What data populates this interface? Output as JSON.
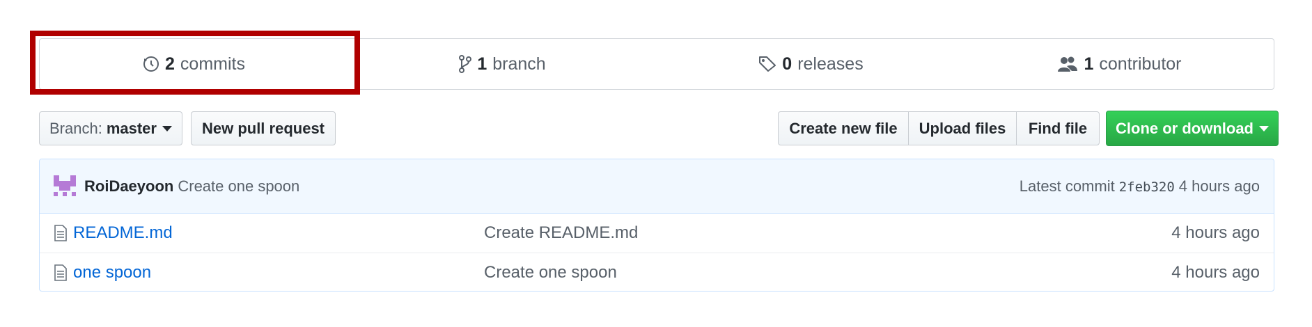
{
  "summary": {
    "commits": {
      "count": "2",
      "label": "commits",
      "icon": "history-icon"
    },
    "branches": {
      "count": "1",
      "label": "branch",
      "icon": "git-branch-icon"
    },
    "releases": {
      "count": "0",
      "label": "releases",
      "icon": "tag-icon"
    },
    "contributors": {
      "count": "1",
      "label": "contributor",
      "icon": "people-icon"
    }
  },
  "toolbar": {
    "branch_prefix": "Branch:",
    "branch_name": "master",
    "new_pull_request": "New pull request",
    "create_new_file": "Create new file",
    "upload_files": "Upload files",
    "find_file": "Find file",
    "clone_or_download": "Clone or download"
  },
  "latest_commit": {
    "author": "RoiDaeyoon",
    "message": "Create one spoon",
    "label": "Latest commit",
    "sha": "2feb320",
    "time": "4 hours ago"
  },
  "files": [
    {
      "name": "README.md",
      "commit_message": "Create README.md",
      "age": "4 hours ago"
    },
    {
      "name": "one spoon",
      "commit_message": "Create one spoon",
      "age": "4 hours ago"
    }
  ],
  "colors": {
    "highlight": "#b00000",
    "clone_button": "#28a745",
    "link": "#0366d6"
  }
}
